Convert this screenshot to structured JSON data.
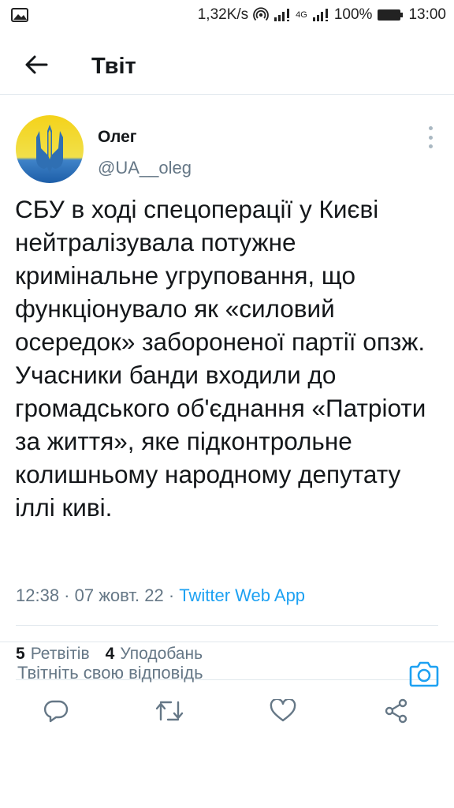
{
  "status_bar": {
    "net_speed": "1,32K/s",
    "network_type": "4G",
    "battery": "100%",
    "time": "13:00",
    "icons": [
      "image-icon",
      "hotspot-icon",
      "signal-icon",
      "battery-icon"
    ]
  },
  "header": {
    "title": "Твіт",
    "back_icon": "arrow-left-icon"
  },
  "tweet": {
    "author_name": "Олег",
    "author_handle": "@UA__oleg",
    "text": "СБУ в ході спецоперації у Києві нейтралізувала потужне кримінальне угруповання, що функціонувало як «силовий осередок» забороненої партії опзж.\nУчасники банди входили до громадського об'єднання «Патріоти за життя», яке підконтрольне колишньому народному депутату іллі киві.",
    "time": "12:38",
    "separator": " · ",
    "date": "07 жовт. 22",
    "source": "Twitter Web App",
    "retweets_count": "5",
    "retweets_label": "Ретвітів",
    "likes_count": "4",
    "likes_label": "Уподобань"
  },
  "actions": [
    "reply-icon",
    "retweet-icon",
    "like-icon",
    "share-icon"
  ],
  "reply": {
    "placeholder": "Твітніть свою відповідь",
    "camera_icon": "camera-icon"
  },
  "colors": {
    "accent": "#1da1f2",
    "secondary_text": "#657786",
    "primary_text": "#14171a",
    "divider": "#e1e8ed"
  }
}
